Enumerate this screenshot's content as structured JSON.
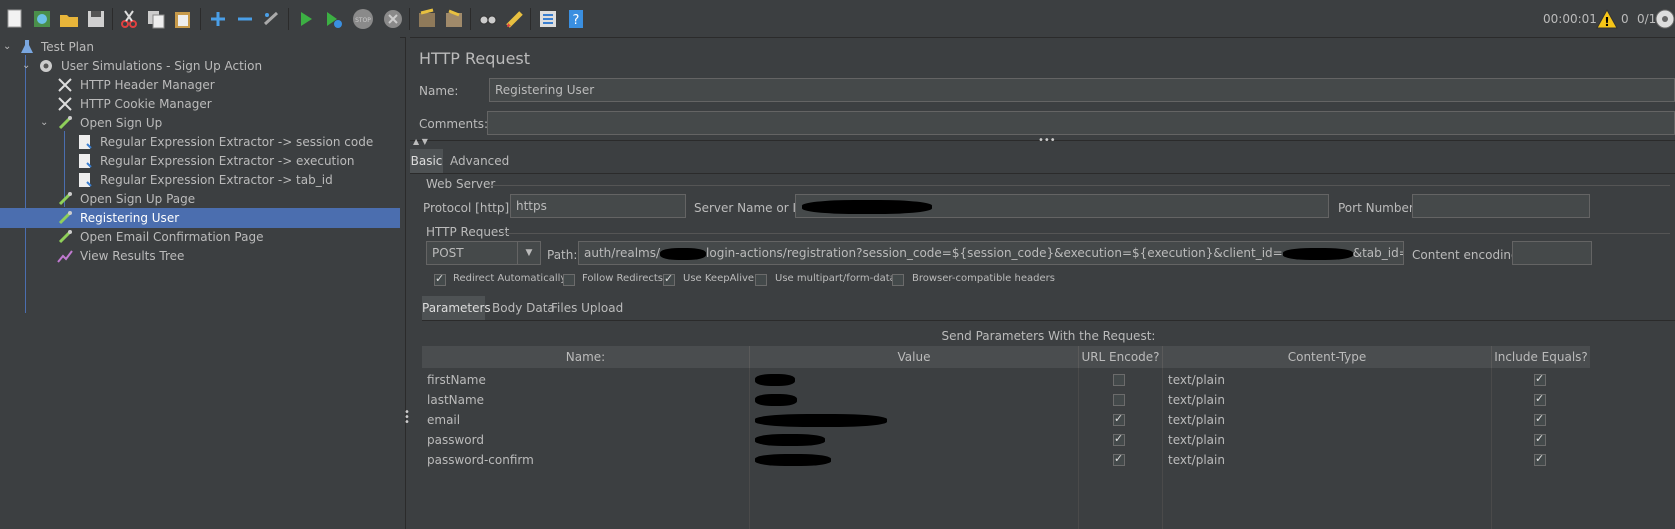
{
  "toolbar": {
    "timer": "00:00:01",
    "warning_count": "0",
    "thread_ratio": "0/1",
    "buttons": [
      "new-icon",
      "templates-icon",
      "open-icon",
      "save-icon",
      "cut-icon",
      "copy-icon",
      "paste-icon",
      "expand-icon",
      "collapse-icon",
      "toggle-icon",
      "start-icon",
      "start-no-pause-icon",
      "stop-icon",
      "shutdown-icon",
      "clear-icon",
      "clear-all-icon",
      "search-icon",
      "reset-search-icon",
      "function-helper-icon",
      "help-icon"
    ]
  },
  "tree": {
    "items": [
      {
        "label": "Test Plan"
      },
      {
        "label": "User Simulations - Sign Up Action"
      },
      {
        "label": "HTTP Header Manager"
      },
      {
        "label": "HTTP Cookie Manager"
      },
      {
        "label": "Open Sign Up"
      },
      {
        "label": "Regular Expression Extractor -> session code"
      },
      {
        "label": "Regular Expression Extractor -> execution"
      },
      {
        "label": "Regular Expression Extractor -> tab_id"
      },
      {
        "label": "Open Sign Up Page"
      },
      {
        "label": "Registering User"
      },
      {
        "label": "Open Email Confirmation Page"
      },
      {
        "label": "View Results Tree"
      }
    ]
  },
  "panel": {
    "title": "HTTP Request",
    "name_label": "Name:",
    "name_value": "Registering User",
    "comments_label": "Comments:",
    "comments_value": "",
    "tabs": [
      "Basic",
      "Advanced"
    ],
    "web_server": {
      "legend": "Web Server",
      "protocol_label": "Protocol [http]:",
      "protocol_value": "https",
      "server_label": "Server Name or IP:",
      "port_label": "Port Number:",
      "port_value": ""
    },
    "http_request": {
      "legend": "HTTP Request",
      "method": "POST",
      "path_label": "Path:",
      "path_part1": "auth/realms/",
      "path_part2": "login-actions/registration?session_code=${session_code}&execution=${execution}&client_id=",
      "path_part3": "&tab_id=${tab_id}",
      "content_encoding_label": "Content encoding:",
      "content_encoding_value": ""
    },
    "options": [
      {
        "label": "Redirect Automatically",
        "checked": true
      },
      {
        "label": "Follow Redirects",
        "checked": false
      },
      {
        "label": "Use KeepAlive",
        "checked": true
      },
      {
        "label": "Use multipart/form-data",
        "checked": false
      },
      {
        "label": "Browser-compatible headers",
        "checked": false
      }
    ],
    "param_tabs": [
      "Parameters",
      "Body Data",
      "Files Upload"
    ],
    "params_caption": "Send Parameters With the Request:",
    "columns": [
      "Name:",
      "Value",
      "URL Encode?",
      "Content-Type",
      "Include Equals?"
    ],
    "rows": [
      {
        "name": "firstName",
        "url_encode": false,
        "content_type": "text/plain",
        "include_equals": true
      },
      {
        "name": "lastName",
        "url_encode": false,
        "content_type": "text/plain",
        "include_equals": true
      },
      {
        "name": "email",
        "url_encode": true,
        "content_type": "text/plain",
        "include_equals": true
      },
      {
        "name": "password",
        "url_encode": true,
        "content_type": "text/plain",
        "include_equals": true
      },
      {
        "name": "password-confirm",
        "url_encode": true,
        "content_type": "text/plain",
        "include_equals": true
      }
    ]
  }
}
